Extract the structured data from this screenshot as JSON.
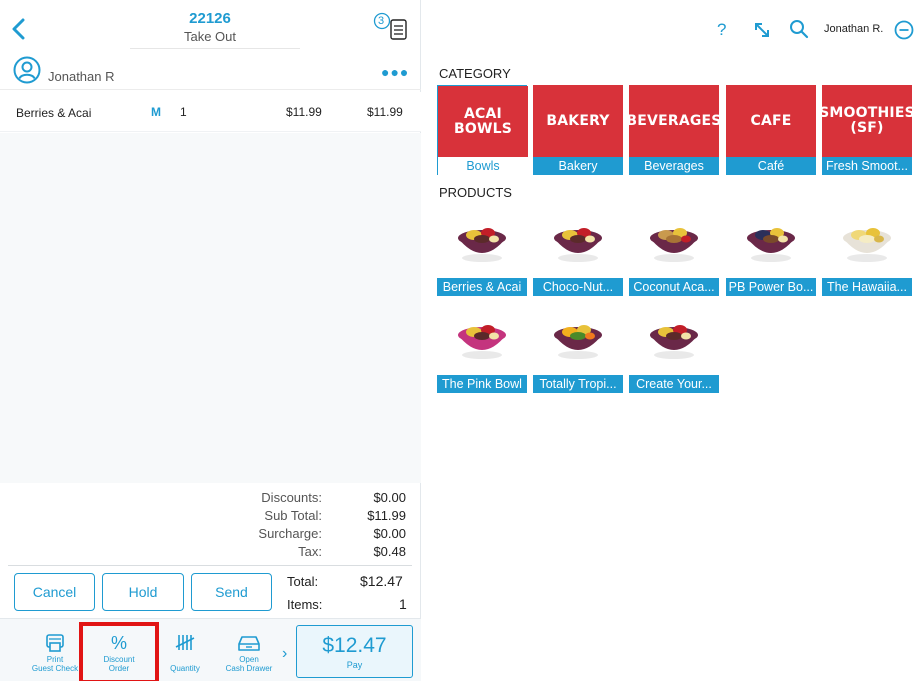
{
  "order": {
    "number": "22126",
    "type": "Take Out",
    "open_orders_count": "3"
  },
  "customer": {
    "name": "Jonathan R"
  },
  "items": [
    {
      "name": "Berries & Acai",
      "modifier": "M",
      "qty": "1",
      "price": "$11.99",
      "total": "$11.99"
    }
  ],
  "totals": {
    "discounts_label": "Discounts:",
    "discounts": "$0.00",
    "subtotal_label": "Sub Total:",
    "subtotal": "$11.99",
    "surcharge_label": "Surcharge:",
    "surcharge": "$0.00",
    "tax_label": "Tax:",
    "tax": "$0.48",
    "total_label": "Total:",
    "total": "$12.47",
    "items_label": "Items:",
    "items": "1"
  },
  "actions": {
    "cancel": "Cancel",
    "hold": "Hold",
    "send": "Send"
  },
  "toolbar": {
    "print_line1": "Print",
    "print_line2": "Guest Check",
    "discount_line1": "Discount",
    "discount_line2": "Order",
    "quantity": "Quantity",
    "drawer_line1": "Open",
    "drawer_line2": "Cash Drawer"
  },
  "pay": {
    "amount": "$12.47",
    "label": "Pay"
  },
  "topbar": {
    "help": "?",
    "user": "Jonathan R."
  },
  "sections": {
    "category": "CATEGORY",
    "products": "PRODUCTS"
  },
  "categories": [
    {
      "title": "ACAI BOWLS",
      "caption": "Bowls",
      "active": true
    },
    {
      "title": "BAKERY",
      "caption": "Bakery"
    },
    {
      "title": "BEVERAGES",
      "caption": "Beverages"
    },
    {
      "title": "CAFE",
      "caption": "Café"
    },
    {
      "title": "SMOOTHIES (SF)",
      "caption": "Fresh Smoot..."
    }
  ],
  "products": [
    {
      "name": "Berries & Acai",
      "bowl": "acai",
      "topping": "berries"
    },
    {
      "name": "Choco-Nut...",
      "bowl": "acai",
      "topping": "berries"
    },
    {
      "name": "Coconut Aca...",
      "bowl": "acai",
      "topping": "granola"
    },
    {
      "name": "PB Power Bo...",
      "bowl": "acai",
      "topping": "blue"
    },
    {
      "name": "The Hawaiia...",
      "bowl": "white",
      "topping": "yellow"
    },
    {
      "name": "The Pink Bowl",
      "bowl": "pink",
      "topping": "berries"
    },
    {
      "name": "Totally Tropi...",
      "bowl": "acai",
      "topping": "tropical"
    },
    {
      "name": "Create Your...",
      "bowl": "acai",
      "topping": "berries"
    }
  ],
  "colors": {
    "accent": "#1f9bd1",
    "category_red": "#d8323a",
    "highlight": "#e11414"
  }
}
